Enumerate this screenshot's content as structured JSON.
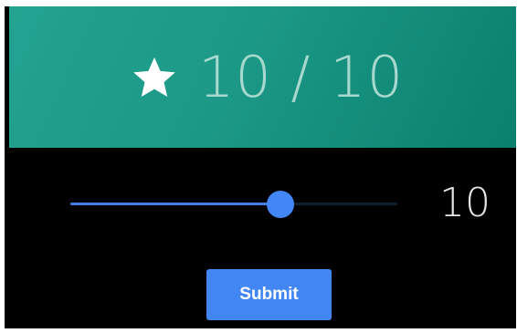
{
  "header": {
    "score_text": "10 / 10",
    "icon": "star-icon",
    "background_color": "#1c9886",
    "score_color": "#a7d8cd"
  },
  "slider": {
    "value": 10,
    "min": 1,
    "max": 15,
    "value_label": "10",
    "fill_color": "#3d7fe5",
    "thumb_color": "#4287f5"
  },
  "submit": {
    "label": "Submit",
    "color": "#4286f4"
  }
}
